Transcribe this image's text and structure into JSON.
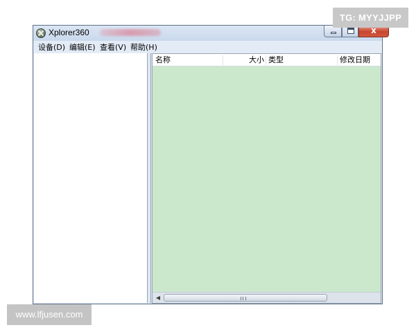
{
  "watermarks": {
    "tg": "TG: MYYJJPP",
    "site": "www.lfjusen.com"
  },
  "window": {
    "title": "Xplorer360",
    "close_glyph": "x"
  },
  "menubar": {
    "items": [
      {
        "label": "设备(D)"
      },
      {
        "label": "编辑(E)"
      },
      {
        "label": "查看(V)"
      },
      {
        "label": "帮助(H)"
      }
    ]
  },
  "list": {
    "columns": [
      {
        "label": "名称"
      },
      {
        "label": "大小"
      },
      {
        "label": "类型"
      },
      {
        "label": "修改日期"
      }
    ]
  },
  "icons": {
    "app": "xbox-icon",
    "minimize": "minimize-icon",
    "maximize": "maximize-icon",
    "close": "close-icon"
  },
  "colors": {
    "list_background": "#cbe8cd",
    "close_button": "#c7452d",
    "titlebar": "#c9d8ec"
  }
}
